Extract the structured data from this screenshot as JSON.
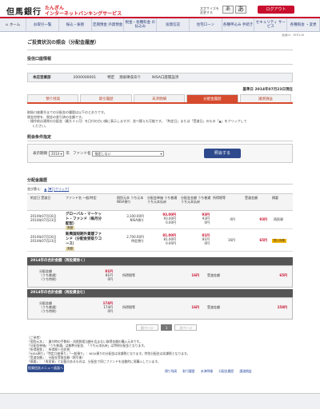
{
  "header": {
    "logo_jp": "但馬銀行",
    "logo_en": "TAJIMA BANK",
    "service_line1": "たんぎん",
    "service_line2": "インターネットバンキングサービス",
    "font_size_label1": "文字サイズを",
    "font_size_label2": "変更する",
    "font_small": "あ",
    "font_large": "あ",
    "logout": "ログアウト"
  },
  "nav": [
    {
      "label": "ホーム"
    },
    {
      "label": "お取引一覧"
    },
    {
      "label": "振込・振替"
    },
    {
      "label": "定期預金 外貨預金"
    },
    {
      "label": "税金・各種料金 の払込み"
    },
    {
      "label": "投資信託"
    },
    {
      "label": "住宅ローン"
    },
    {
      "label": "各種申込み 手続き"
    },
    {
      "label": "セキュリティ サービス"
    },
    {
      "label": "各種照会 ・変更"
    }
  ],
  "screen_id": "画面ID：BFR108",
  "page_title": "ご投資状況の照会（分配金履歴）",
  "account_section": "投信口座情報",
  "account": {
    "branch": "本店営業部",
    "number": "2000000001",
    "type": "特定",
    "tax": "源泉徴収あり",
    "nisa": "NISA口座開設済"
  },
  "base_date": "基準日 2014年07月23日現在",
  "tabs": [
    {
      "label": "預り残高"
    },
    {
      "label": "取引履歴"
    },
    {
      "label": "未済明細"
    },
    {
      "label": "分配金履歴"
    },
    {
      "label": "譲渡損益"
    }
  ],
  "notes": [
    "取扱口座番号までの分配金の履歴は以下のとおりです。",
    "税金控除を、税金の差引済の金額です。",
    "・操作前は通常の分配金（最大３ヶ月）を日付の古い順に表示しますが、並べ替えも可能です。「約定日」または「受渡日」のもの「▲」をクリックして",
    "ください。"
  ],
  "cond_section": "照会条件指定",
  "cond": {
    "period_label": "表示期間",
    "year": "2014",
    "year_suffix": "年",
    "fund_label": "ファンド名",
    "fund_value": "指定しない",
    "submit": "照会する"
  },
  "history_section": "分配金履歴",
  "sort": {
    "label": "並び替え：",
    "asc": "▲",
    "desc": "[▼]",
    "tip": "[クリック]"
  },
  "columns": {
    "date": "約定日 受渡日",
    "fund": "ファンド名 一般/特定",
    "price": "個別元本 うち元本 NISA預り",
    "dist": "分配金単価 うち普通 うち元本払戻",
    "amount": "分配金金額 うち普通 うち元本払戻",
    "tax": "所得税等",
    "recv": "受渡金額",
    "note": "摘要"
  },
  "rows": [
    {
      "date1": "2014年07月16日",
      "date2": "2014年07月23日",
      "fund1": "グローバル・マーケッ",
      "fund2": "ト・ファンド（毎月分",
      "fund3": "配型）",
      "kind": "実額",
      "price1": "3,100.00円",
      "price2": "NISA預り",
      "d1": "93.00円",
      "d2": "93.00円",
      "d3": "0.00円",
      "a1": "93円",
      "a2": "93円",
      "a3": "0円",
      "tax": "0円",
      "recv": "93円",
      "note": "再投資"
    },
    {
      "date1": "2014年07月16日",
      "date2": "2014年07月23日",
      "fund1": "新興国短期外貨建ファ",
      "fund2": "ンド（分配金受取りコ",
      "fund3": "ース）",
      "kind": "実額",
      "price1": "2,700.00円",
      "price2": "特定預り",
      "d1": "81.00円",
      "d2": "81.00円",
      "d3": "0.00円",
      "a1": "81円",
      "a2": "81円",
      "a3": "0円",
      "tax": "16円",
      "recv": "65円",
      "note": "受入対象"
    }
  ],
  "totals": [
    {
      "title": "2014年の合計金額（再投資除く）",
      "l1": "分配金額",
      "l2": "（うち普通）",
      "l3": "（うち特例）",
      "v1": "81円",
      "v2": "81円",
      "v3": "0円",
      "tax_label": "所得税等",
      "tax": "16円",
      "recv_label": "受渡金額",
      "recv": "65円"
    },
    {
      "title": "2014年の合計金額（再投資含む）",
      "l1": "分配金額",
      "l2": "（うち普通）",
      "l3": "（うち特例）",
      "v1": "174円",
      "v2": "174円",
      "v3": "0円",
      "tax_label": "所得税等",
      "tax": "16円",
      "recv_label": "受渡金額",
      "recv": "158円"
    }
  ],
  "pager": {
    "prev": "前ページ",
    "page": "1",
    "next": "次ページ"
  },
  "footnotes": [
    "（ご参考）",
    "「個別元本」：買付時の手数料・消費税相当額を含まない取得金額の購入元本です。",
    "「分配金単価」「うち普通」は基準分配金、「うち元本払戻」は特例分配金となります。",
    "「所得税等」：所得税＋住民税",
    "「NISA預り」「特定口座預り」「一般預り」：NISA預りの分配金は非課税となります。特別分配金は非課税となります。",
    "「受渡金額」：分配金受取金額（税引後）",
    "「摘要」：「再投資」と記載のあるものは、分配金で同じファンドを自動的に再購入しています。",
    "「受入対象」と記載のあるものは、特定口座による配当等を再入金しています。"
  ],
  "back_button": "投資信託メニュー画面へ",
  "footer_links": [
    "預り残高",
    "取引履歴",
    "未済明細",
    "分配金履歴",
    "譲渡損益"
  ]
}
